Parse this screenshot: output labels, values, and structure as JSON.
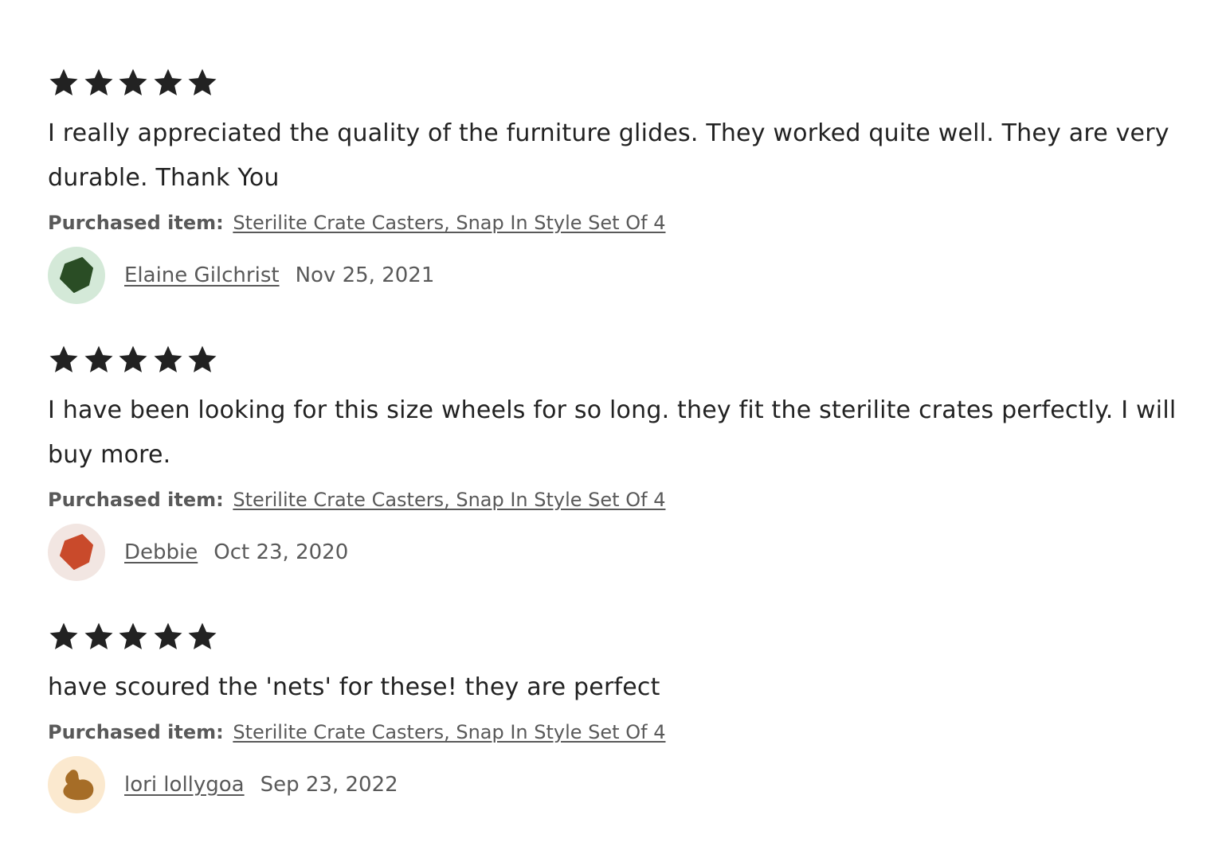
{
  "reviews": [
    {
      "rating": 5,
      "max_rating": 5,
      "text": "I really appreciated the quality of the furniture glides. They worked quite well. They are very durable. Thank You",
      "purchased_label": "Purchased item:",
      "purchased_item": "Sterilite Crate Casters, Snap In Style Set Of 4",
      "reviewer": "Elaine Gilchrist",
      "date": "Nov 25, 2021",
      "avatar_icon": "pentagon-avatar-icon",
      "avatar_bg": "#d4e9d8",
      "avatar_fg": "#2a4d25"
    },
    {
      "rating": 5,
      "max_rating": 5,
      "text": "I have been looking for this size wheels for so long. they fit the sterilite crates perfectly. I will buy more.",
      "purchased_label": "Purchased item:",
      "purchased_item": "Sterilite Crate Casters, Snap In Style Set Of 4",
      "reviewer": "Debbie",
      "date": "Oct 23, 2020",
      "avatar_icon": "pentagon-avatar-icon",
      "avatar_bg": "#f2e6e2",
      "avatar_fg": "#c94a2b"
    },
    {
      "rating": 5,
      "max_rating": 5,
      "text": "have scoured the 'nets' for these! they are perfect",
      "purchased_label": "Purchased item:",
      "purchased_item": "Sterilite Crate Casters, Snap In Style Set Of 4",
      "reviewer": "lori lollygoa",
      "date": "Sep 23, 2022",
      "avatar_icon": "blob-avatar-icon",
      "avatar_bg": "#fbe9cf",
      "avatar_fg": "#a66d27"
    }
  ],
  "colors": {
    "star": "#222222",
    "text": "#222222",
    "muted": "#595959"
  }
}
